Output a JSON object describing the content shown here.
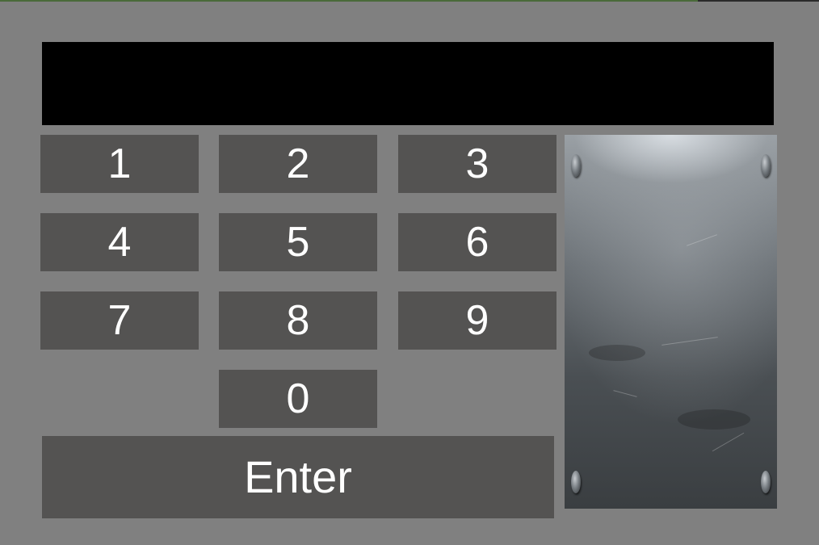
{
  "display": {
    "value": ""
  },
  "keypad": {
    "keys": [
      "1",
      "2",
      "3",
      "4",
      "5",
      "6",
      "7",
      "8",
      "9",
      "0"
    ],
    "enter_label": "Enter"
  },
  "colors": {
    "background": "#808080",
    "display": "#000000",
    "key": "#545352",
    "key_text": "#ffffff"
  }
}
